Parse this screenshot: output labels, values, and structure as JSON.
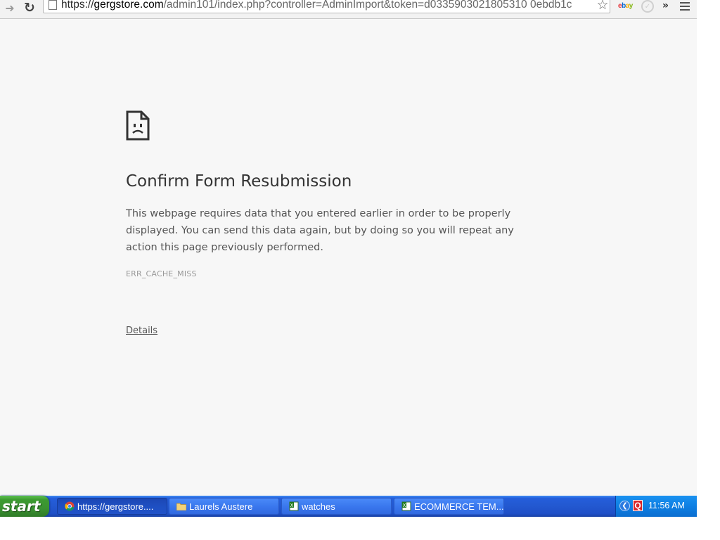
{
  "browser": {
    "url_prefix": "https://",
    "url_host": "gergstore.com",
    "url_rest": "/admin101/index.php?controller=AdminImport&token=d0335903021805310 0ebdb1c",
    "extensions": [
      {
        "name": "ebay-icon",
        "label_parts": [
          "e",
          "b",
          "a",
          "y"
        ],
        "colors": [
          "#e53238",
          "#0064d2",
          "#f5af02",
          "#86b817"
        ]
      }
    ]
  },
  "error_page": {
    "title": "Confirm Form Resubmission",
    "message": "This webpage requires data that you entered earlier in order to be properly displayed. You can send this data again, but by doing so you will repeat any action this page previously performed.",
    "error_code": "ERR_CACHE_MISS",
    "details_link": "Details"
  },
  "taskbar": {
    "start_label": "start",
    "tasks": [
      {
        "label": "https://gergstore....",
        "icon": "chrome-icon",
        "active": true
      },
      {
        "label": "Laurels Austere",
        "icon": "folder-icon",
        "active": false
      },
      {
        "label": "watches",
        "icon": "excel-icon",
        "active": false
      },
      {
        "label": "ECOMMERCE TEM...",
        "icon": "excel-icon",
        "active": false
      }
    ],
    "clock": "11:56 AM"
  },
  "colors": {
    "page_background": "#f7f7f7",
    "taskbar_blue": "#245edb",
    "start_green": "#3c9a31"
  }
}
